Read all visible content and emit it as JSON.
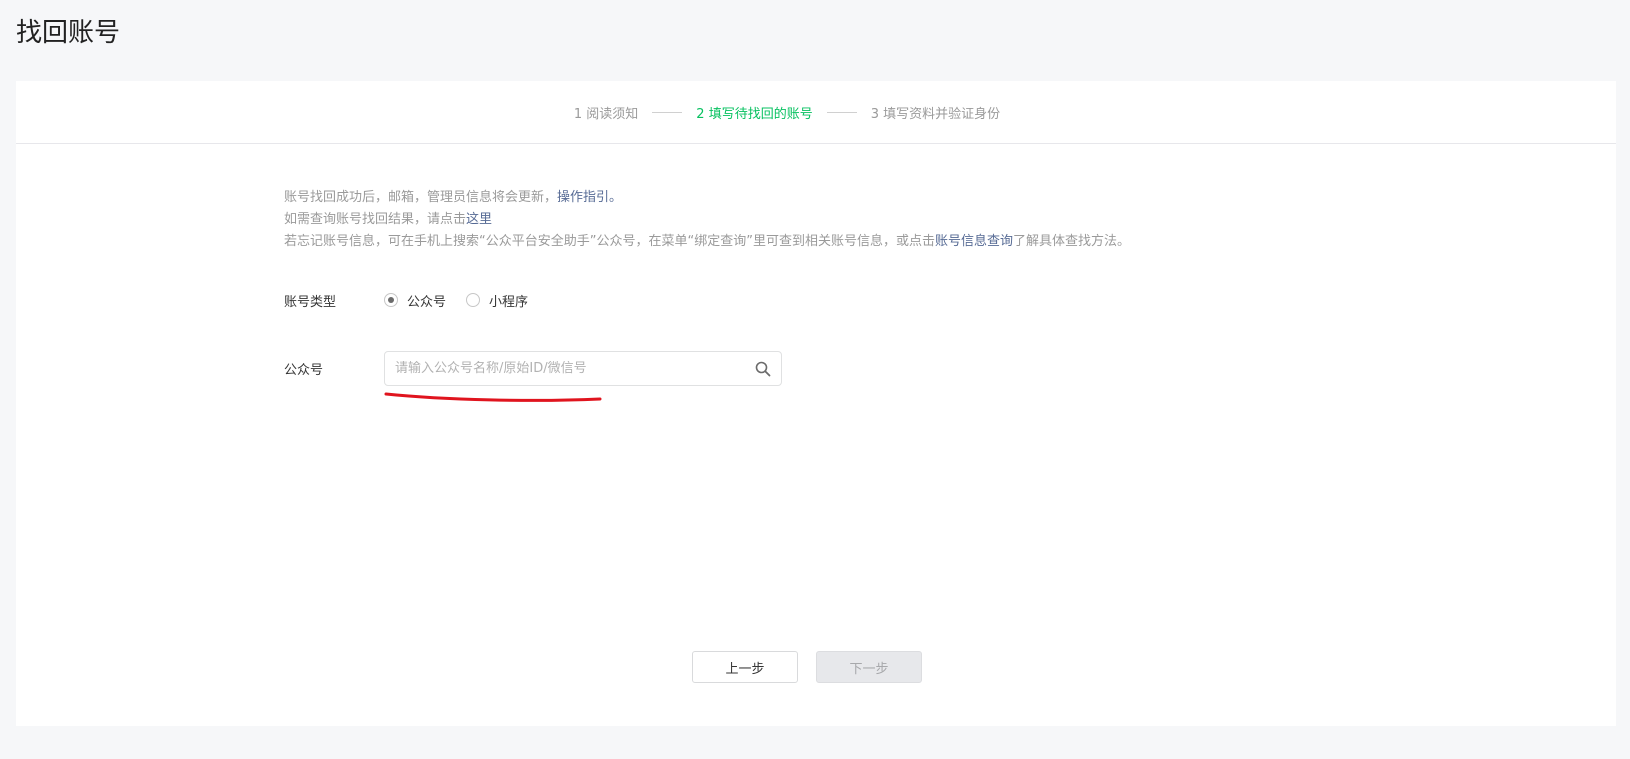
{
  "page": {
    "title": "找回账号"
  },
  "steps": [
    {
      "label": "1 阅读须知",
      "active": false
    },
    {
      "label": "2 填写待找回的账号",
      "active": true
    },
    {
      "label": "3 填写资料并验证身份",
      "active": false
    }
  ],
  "notes": {
    "line1_text": "账号找回成功后，邮箱，管理员信息将会更新，",
    "line1_link": "操作指引",
    "line1_end": "。",
    "line2_text": "如需查询账号找回结果，请点击",
    "line2_link": "这里",
    "line3_text": "若忘记账号信息，可在手机上搜索“公众平台安全助手”公众号，在菜单“绑定查询”里可查到相关账号信息，或点击",
    "line3_link": "账号信息查询",
    "line3_end": "了解具体查找方法。"
  },
  "form": {
    "account_type_label": "账号类型",
    "options": [
      {
        "label": "公众号",
        "checked": true
      },
      {
        "label": "小程序",
        "checked": false
      }
    ],
    "account_label": "公众号",
    "search": {
      "placeholder": "请输入公众号名称/原始ID/微信号",
      "value": ""
    }
  },
  "buttons": {
    "prev": "上一步",
    "next": "下一步"
  },
  "colors": {
    "accent": "#07c160",
    "link": "#576b95",
    "annotation": "#e0141e"
  },
  "icons": {
    "search": "search-icon"
  }
}
